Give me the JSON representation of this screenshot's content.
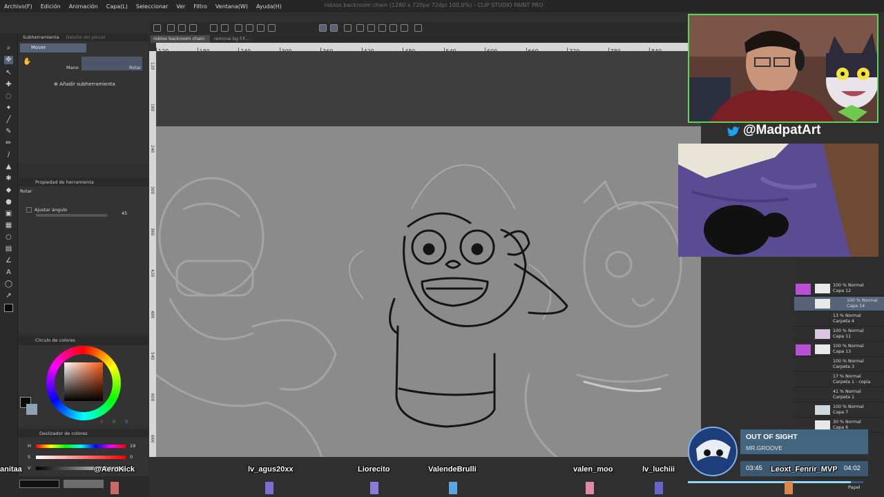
{
  "menubar": {
    "items": [
      "Archivo(F)",
      "Edición",
      "Animación",
      "Capa(L)",
      "Seleccionar",
      "Ver",
      "Filtro",
      "Ventana(W)",
      "Ayuda(H)"
    ],
    "window_title": "roblox backroom chain (1280 x 720px 72dpi 100.0%)  - CLIP STUDIO PAINT PRO"
  },
  "subtool_panel": {
    "title": "Subherramienta",
    "title_faded": "Detalle del pincel",
    "selected": "Mover",
    "item_mano": "Mano",
    "item_rotar": "Rotar",
    "add_label": "Añadir subherramienta"
  },
  "tool_property": {
    "title": "Propiedad de herramienta",
    "tool_name": "Rotar",
    "adjust_angle_label": "Ajustar ángulo",
    "angle_value": "45"
  },
  "color_wheel": {
    "title": "Círculo de colores",
    "main_color": "#0b0b0b",
    "sub_color": "#8aa3b5",
    "value_a": "0",
    "value_b": "0",
    "value_c": "0"
  },
  "color_slider": {
    "title": "Deslizador de colores",
    "h_label": "H",
    "h_value": "19",
    "s_label": "S",
    "s_value": "0",
    "v_label": "V",
    "v_value": "0"
  },
  "doc_tabs": [
    {
      "label": "roblox backroom chain"
    },
    {
      "label": "remove bg f-F..."
    }
  ],
  "ruler_ticks": [
    "120",
    "180",
    "240",
    "300",
    "360",
    "420",
    "480",
    "540",
    "600",
    "660",
    "720",
    "780",
    "840",
    "900",
    "960",
    "1020",
    "1080",
    "1140",
    "1200"
  ],
  "ruler_left_ticks": [
    "120",
    "180",
    "240",
    "300",
    "360",
    "420",
    "480",
    "540",
    "600",
    "660"
  ],
  "overlay": {
    "twitter_handle": "@MadpatArt"
  },
  "layers": [
    {
      "mode": "100 % Normal",
      "name": "Capa 12",
      "marked": true
    },
    {
      "mode": "100 % Normal",
      "name": "Capa 14",
      "selected": true
    },
    {
      "mode": "13 % Normal",
      "name": "Carpeta 4"
    },
    {
      "mode": "100 % Normal",
      "name": "Capa 11"
    },
    {
      "mode": "100 % Normal",
      "name": "Capa 13",
      "marked": true
    },
    {
      "mode": "100 % Normal",
      "name": "Carpeta 3"
    },
    {
      "mode": "17 % Normal",
      "name": "Carpeta 1 - copia"
    },
    {
      "mode": "41 % Normal",
      "name": "Carpeta 1"
    },
    {
      "mode": "100 % Normal",
      "name": "Capa 7"
    },
    {
      "mode": "30 % Normal",
      "name": "Capa 6"
    }
  ],
  "layer_bottom": {
    "name": "Papel"
  },
  "now_playing": {
    "title": "OUT OF SIGHT",
    "artist": "MR.GROOVE",
    "elapsed": "03:45",
    "total": "04:02",
    "progress": 0.93
  },
  "chat": {
    "names": [
      "anitaa",
      "@AeroKick",
      "lv_agus20xx",
      "Liorecito",
      "ValendeBrulli",
      "valen_moo",
      "lv_luchiii",
      "Leoxt_Fenrir_MVP"
    ]
  },
  "colors": {
    "accent": "#556277",
    "layer_mark": "#b94fd4",
    "webcam_border": "#5fd45a"
  }
}
